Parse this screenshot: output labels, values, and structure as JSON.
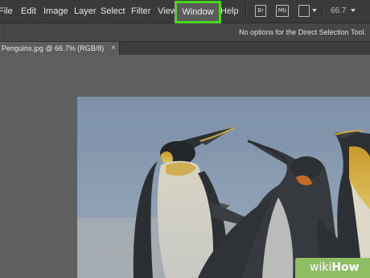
{
  "menubar": {
    "items": [
      "File",
      "Edit",
      "Image",
      "Layer",
      "Select",
      "Filter",
      "View",
      "Window",
      "Help"
    ],
    "highlighted": "Window",
    "highlight_color": "#4ad71e"
  },
  "toolbar": {
    "bridge_icon": "Br",
    "minibridge_icon": "Mb",
    "arrange_icon": "arrange-documents-icon",
    "zoom_value": "66.7"
  },
  "options_bar": {
    "text": "No options for the Direct Selection Tool."
  },
  "document": {
    "tab_label": "Penguins.jpg @ 66.7% (RGB/8)",
    "close_glyph": "×"
  },
  "watermark": {
    "brand": "wikiHow",
    "brand_part1": "wiki",
    "brand_part2": "How",
    "color": "#8ebd63"
  }
}
